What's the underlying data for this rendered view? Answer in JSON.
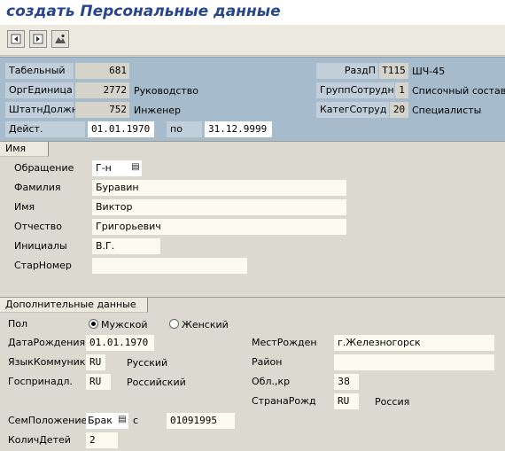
{
  "window": {
    "title": "создать Персональные данные"
  },
  "toolbar": {
    "buttons": [
      {
        "icon": "previous-record-icon"
      },
      {
        "icon": "next-record-icon"
      },
      {
        "icon": "overview-icon"
      }
    ]
  },
  "header": {
    "personnel_no_label": "Табельный",
    "personnel_no": "681",
    "org_unit_label": "ОргЕдиница",
    "org_unit": "2772",
    "org_unit_text": "Руководство",
    "position_label": "ШтатнДолжн",
    "position": "752",
    "position_text": "Инженер",
    "valid_label": "Дейст.",
    "valid_from": "01.01.1970",
    "valid_to_label": "по",
    "valid_to": "31.12.9999",
    "subarea_label": "РаздП",
    "subarea": "T115",
    "subarea_text": "ШЧ-45",
    "ee_group_label": "ГруппСотрудн",
    "ee_group": "1",
    "ee_group_text": "Списочный состав",
    "ee_category_label": "КатегСотруд",
    "ee_category": "20",
    "ee_category_text": "Специалисты"
  },
  "name_section": {
    "title": "Имя",
    "salutation_label": "Обращение",
    "salutation": "Г-н",
    "last_name_label": "Фамилия",
    "last_name": "Буравин",
    "first_name_label": "Имя",
    "first_name": "Виктор",
    "middle_name_label": "Отчество",
    "middle_name": "Григорьевич",
    "initials_label": "Инициалы",
    "initials": "В.Г.",
    "old_number_label": "СтарНомер",
    "old_number": ""
  },
  "additional_section": {
    "title": "Дополнительные данные",
    "gender_label": "Пол",
    "gender_male": "Мужской",
    "gender_female": "Женский",
    "gender_selected": "male",
    "birth_date_label": "ДатаРождения",
    "birth_date": "01.01.1970",
    "language_label": "ЯзыкКоммуник",
    "language_code": "RU",
    "language_text": "Русский",
    "nationality_label": "Госпринадл.",
    "nationality_code": "RU",
    "nationality_text": "Российский",
    "birthplace_label": "МестРожден",
    "birthplace": "г.Железногорск",
    "district_label": "Район",
    "district": "",
    "region_label": "Обл.,кр",
    "region": "38",
    "birth_country_label": "СтранаРожд",
    "birth_country_code": "RU",
    "birth_country_text": "Россия",
    "marital_status_label": "СемПоложение",
    "marital_status": "Брак",
    "since_label": "с",
    "since": "01091995",
    "children_label": "КоличДетей",
    "children": "2"
  }
}
